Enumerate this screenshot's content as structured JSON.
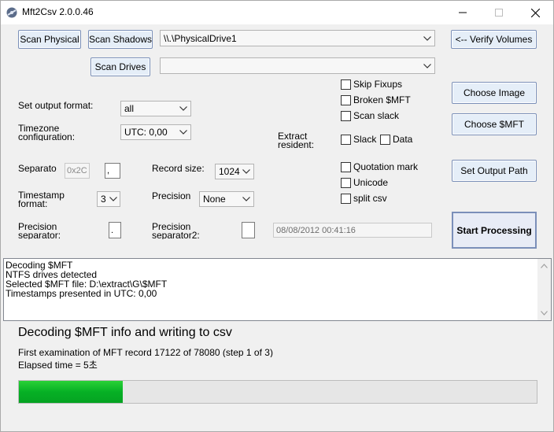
{
  "window": {
    "title": "Mft2Csv 2.0.0.46",
    "icons": {
      "app": "app-icon",
      "minimize": "minimize-icon",
      "maximize": "maximize-icon",
      "close": "close-icon"
    }
  },
  "top": {
    "scan_physical": "Scan Physical",
    "scan_shadows": "Scan Shadows",
    "drive_select": "\\\\.\\PhysicalDrive1",
    "verify_volumes": "<-- Verify Volumes",
    "scan_drives": "Scan Drives",
    "second_select": ""
  },
  "options": {
    "output_format_label": "Set output format:",
    "output_format_value": "all",
    "timezone_label_line1": "Timezone",
    "timezone_label_line2": "configuration:",
    "timezone_value": "UTC: 0,00",
    "extract_label_line1": "Extract",
    "extract_label_line2": "resident:",
    "separator_label": "Separato",
    "separator_hint": "0x2C",
    "separator_value": ",",
    "record_size_label": "Record size:",
    "record_size_value": "1024",
    "timestamp_label_line1": "Timestamp",
    "timestamp_label_line2": "format:",
    "timestamp_value": "3",
    "precision_label": "Precision",
    "precision_value": "None",
    "precision_sep_label_line1": "Precision",
    "precision_sep_label_line2": "separator:",
    "precision_sep_value": ".",
    "precision_sep2_label_line1": "Precision",
    "precision_sep2_label_line2": "separator2:",
    "precision_sep2_value": "",
    "datetime_value": "08/08/2012 00:41:16"
  },
  "checkboxes": {
    "skip_fixups": "Skip Fixups",
    "broken_mft": "Broken $MFT",
    "scan_slack": "Scan slack",
    "slack": "Slack",
    "data": "Data",
    "quotation_mark": "Quotation mark",
    "unicode": "Unicode",
    "split_csv": "split csv"
  },
  "right_buttons": {
    "choose_image": "Choose Image",
    "choose_mft": "Choose $MFT",
    "set_output_path": "Set Output Path",
    "start_processing": "Start Processing"
  },
  "log": {
    "lines": [
      "Decoding $MFT",
      "NTFS drives detected",
      "Selected $MFT file: D:\\extract\\G\\$MFT",
      "Timestamps presented in UTC: 0,00"
    ]
  },
  "status": {
    "heading": "Decoding $MFT info and writing to csv",
    "detail": "First examination of MFT record 17122 of 78080 (step 1 of 3)",
    "elapsed": "Elapsed time = 5초",
    "progress_fraction": 0.2
  }
}
